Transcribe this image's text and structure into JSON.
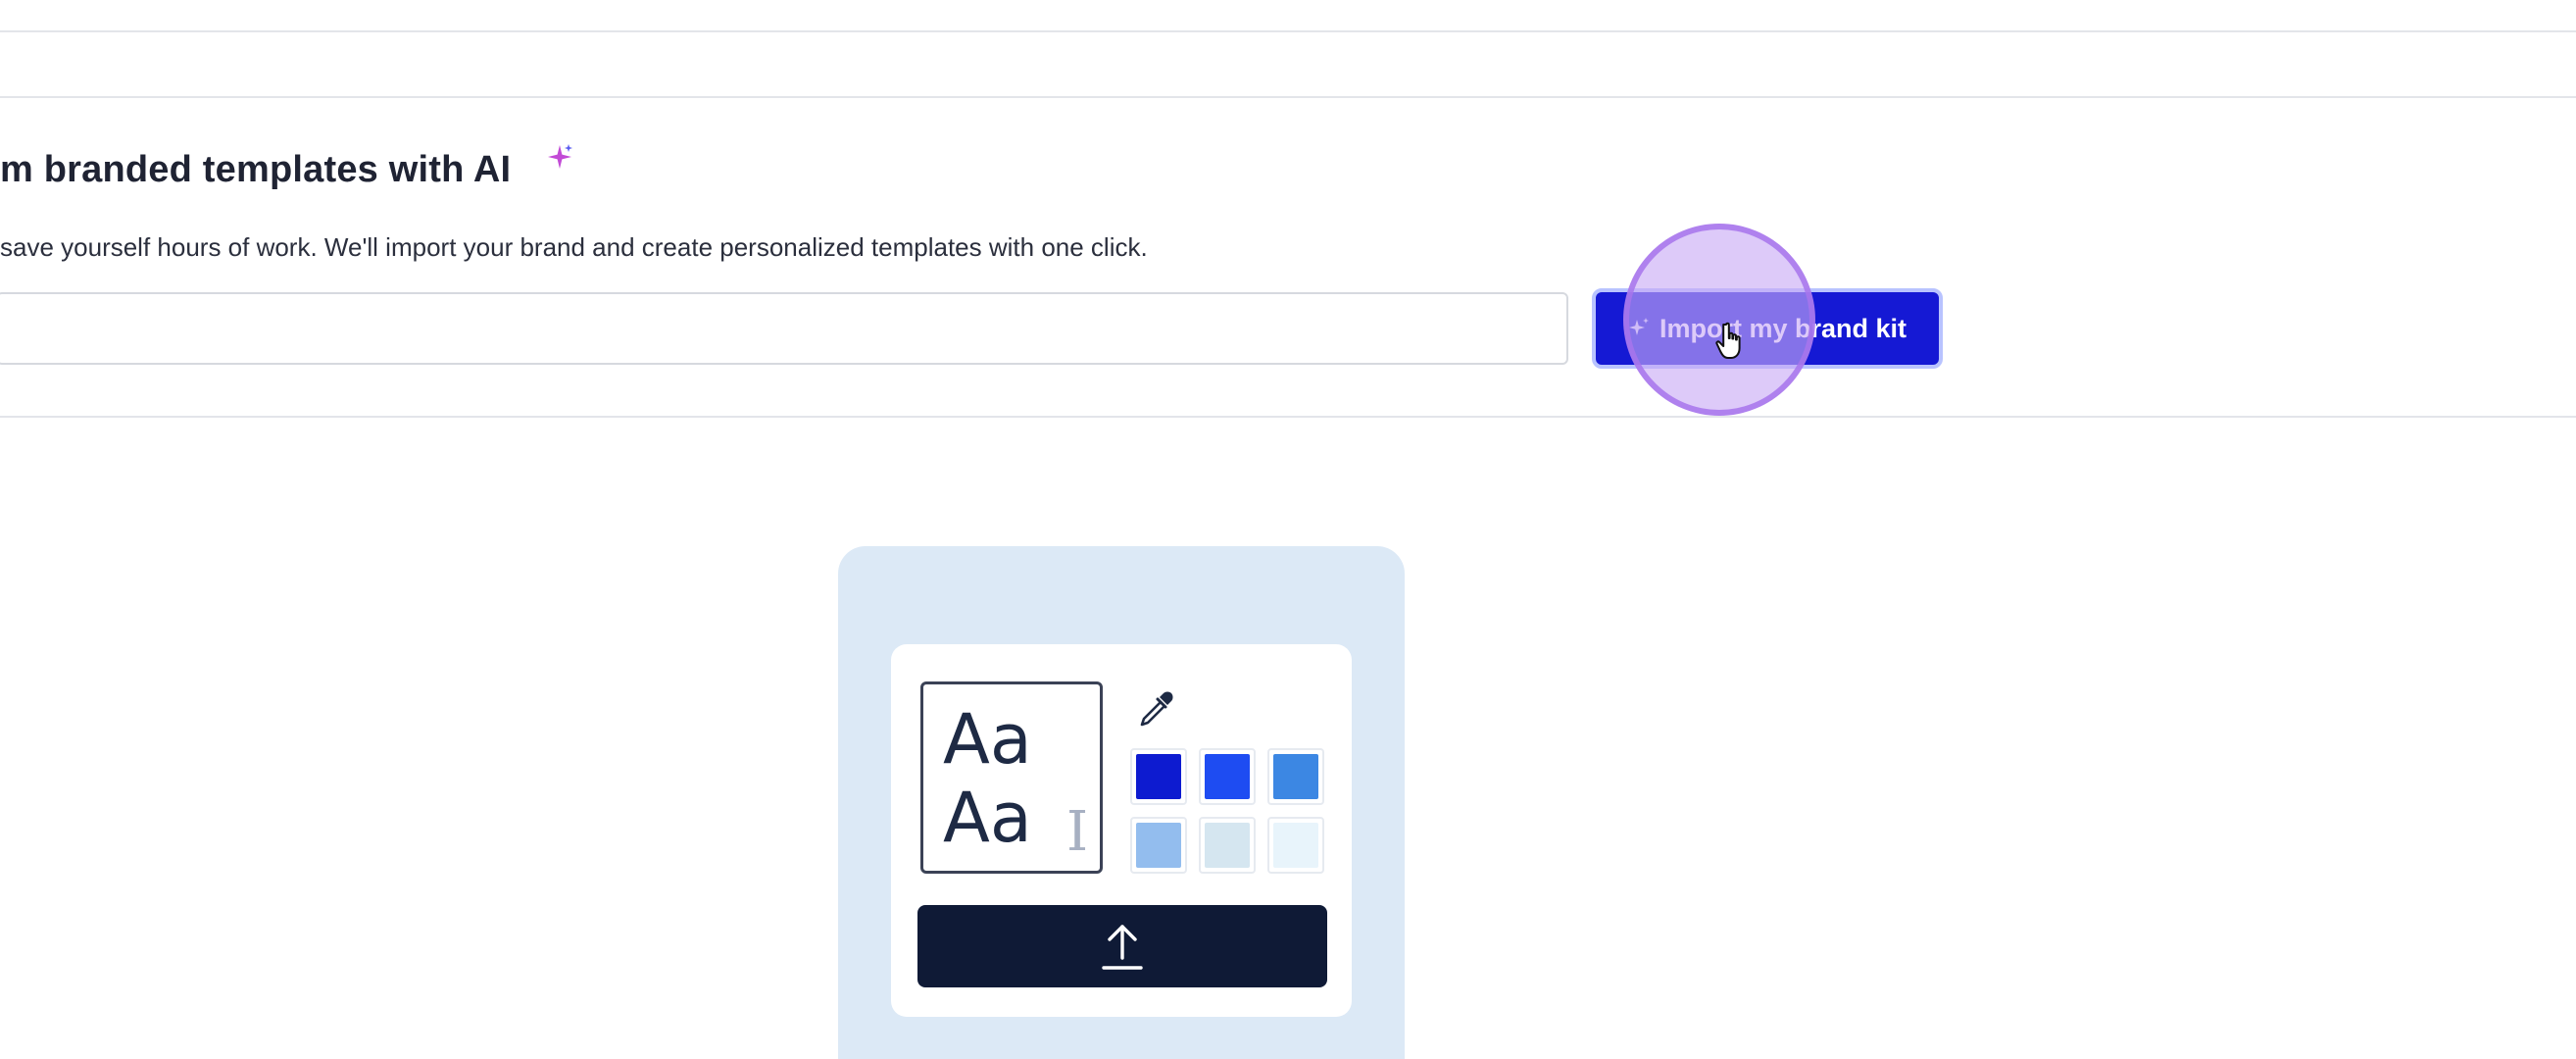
{
  "section": {
    "title": "m branded templates with AI",
    "description": "save yourself hours of work. We'll import your brand and create personalized templates with one click."
  },
  "url_input": {
    "value": "",
    "placeholder": ""
  },
  "import_button": {
    "label": "Import my brand kit",
    "icon": "sparkle-icon"
  },
  "illustration": {
    "type_sample_line1": "Aa",
    "type_sample_line2": "Aa",
    "text_cursor": "I",
    "picker_icon": "eyedropper-icon",
    "upload_icon": "upload-arrow-icon",
    "swatches": [
      "#0d1bd0",
      "#1e4cf2",
      "#3c87e3",
      "#93bdee",
      "#d5e6f0",
      "#e8f4fb"
    ]
  },
  "colors": {
    "accent": "#1519d4",
    "accent_ring": "#b8c3ff",
    "illustration_bg": "#dce9f6",
    "upload_bar": "#0f1a36",
    "sparkle_pink": "#d64bb8",
    "sparkle_blue": "#5a5cf0"
  }
}
